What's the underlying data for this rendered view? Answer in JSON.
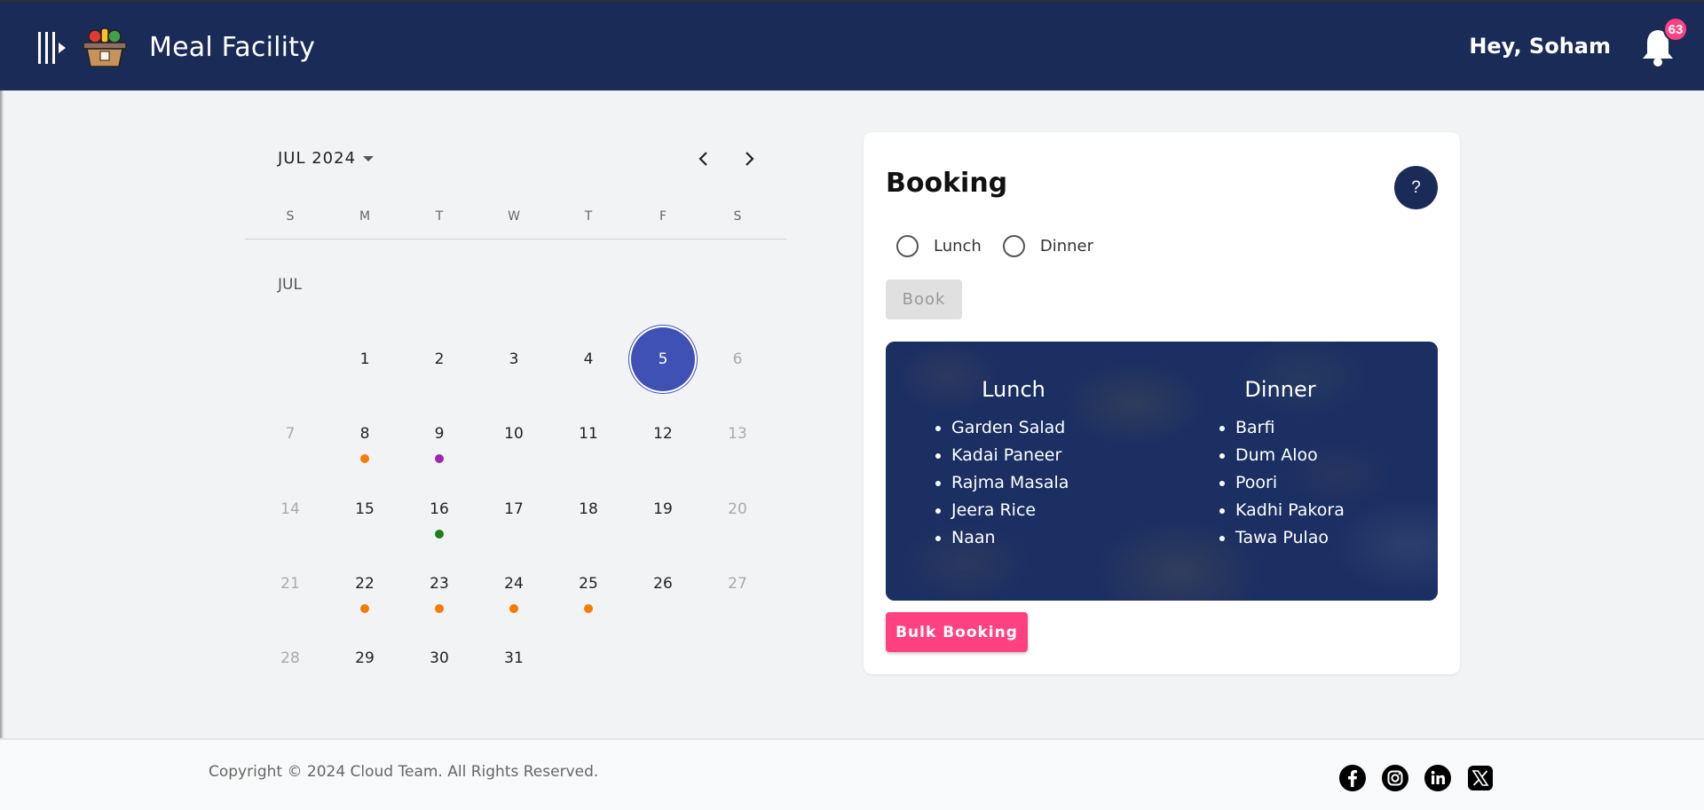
{
  "header": {
    "title": "Meal Facility",
    "greeting": "Hey, Soham",
    "notification_count": "63",
    "icons": [
      "menu-toggle-icon",
      "food-basket-logo",
      "bell-icon"
    ],
    "background": "#1b2b57"
  },
  "calendar": {
    "month_year": "JUL 2024",
    "month_label": "JUL",
    "weekdays": [
      "S",
      "M",
      "T",
      "W",
      "T",
      "F",
      "S"
    ],
    "first_weekday_index": 1,
    "days_in_month": 31,
    "selected_day": 5,
    "selected_color": "#3f51b5",
    "day_labels": [
      "1",
      "2",
      "3",
      "4",
      "5",
      "6",
      "7",
      "8",
      "9",
      "10",
      "11",
      "12",
      "13",
      "14",
      "15",
      "16",
      "17",
      "18",
      "19",
      "20",
      "21",
      "22",
      "23",
      "24",
      "25",
      "26",
      "27",
      "28",
      "29",
      "30",
      "31"
    ],
    "markers": [
      {
        "day": 8,
        "color": "#f57c00"
      },
      {
        "day": 9,
        "color": "#9c27b0"
      },
      {
        "day": 16,
        "color": "#1b7f1b"
      },
      {
        "day": 22,
        "color": "#f57c00"
      },
      {
        "day": 23,
        "color": "#f57c00"
      },
      {
        "day": 24,
        "color": "#f57c00"
      },
      {
        "day": 25,
        "color": "#f57c00"
      }
    ]
  },
  "booking": {
    "title": "Booking",
    "help_label": "?",
    "options": [
      "Lunch",
      "Dinner"
    ],
    "book_label": "Book",
    "bulk_label": "Bulk Booking",
    "accent": "#ff4081",
    "menu": {
      "lunch_title": "Lunch",
      "lunch_items": [
        "Garden Salad",
        "Kadai Paneer",
        "Rajma Masala",
        "Jeera Rice",
        "Naan"
      ],
      "dinner_title": "Dinner",
      "dinner_items": [
        "Barfi",
        "Dum Aloo",
        "Poori",
        "Kadhi Pakora",
        "Tawa Pulao"
      ]
    }
  },
  "footer": {
    "copyright": "Copyright © 2024 Cloud Team. All Rights Reserved.",
    "social": [
      "facebook-icon",
      "instagram-icon",
      "linkedin-icon",
      "x-icon"
    ]
  }
}
